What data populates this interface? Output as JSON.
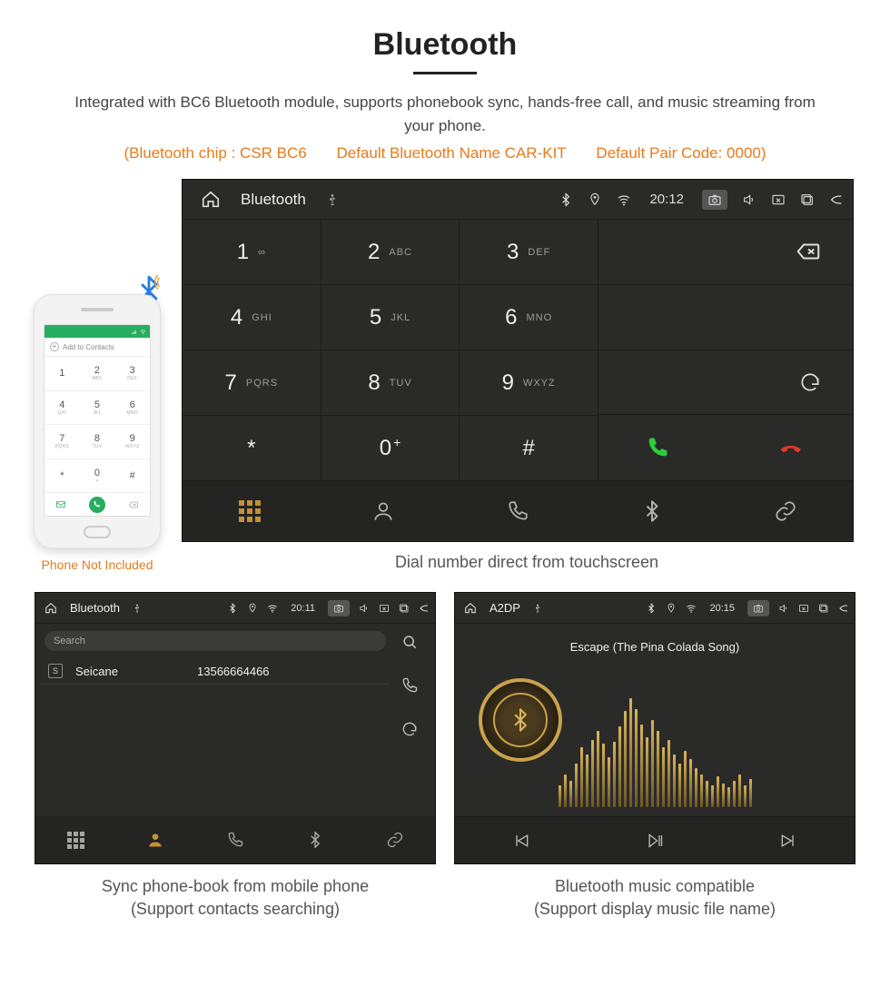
{
  "header": {
    "title": "Bluetooth",
    "subtitle": "Integrated with BC6 Bluetooth module, supports phonebook sync, hands-free call, and music streaming from your phone.",
    "spec_chip": "(Bluetooth chip : CSR BC6",
    "spec_name": "Default Bluetooth Name CAR-KIT",
    "spec_code": "Default Pair Code: 0000)"
  },
  "phone": {
    "header_label": "Add to Contacts",
    "pad": [
      {
        "n": "1",
        "s": ""
      },
      {
        "n": "2",
        "s": "ABC"
      },
      {
        "n": "3",
        "s": "DEF"
      },
      {
        "n": "4",
        "s": "GHI"
      },
      {
        "n": "5",
        "s": "JKL"
      },
      {
        "n": "6",
        "s": "MNO"
      },
      {
        "n": "7",
        "s": "PQRS"
      },
      {
        "n": "8",
        "s": "TUV"
      },
      {
        "n": "9",
        "s": "WXYZ"
      },
      {
        "n": "*",
        "s": ""
      },
      {
        "n": "0",
        "s": "+"
      },
      {
        "n": "#",
        "s": ""
      }
    ],
    "caption": "Phone Not Included"
  },
  "dialer": {
    "title": "Bluetooth",
    "time": "20:12",
    "keys": [
      {
        "n": "1",
        "s": "∞"
      },
      {
        "n": "2",
        "s": "ABC"
      },
      {
        "n": "3",
        "s": "DEF"
      },
      {
        "n": "4",
        "s": "GHI"
      },
      {
        "n": "5",
        "s": "JKL"
      },
      {
        "n": "6",
        "s": "MNO"
      },
      {
        "n": "7",
        "s": "PQRS"
      },
      {
        "n": "8",
        "s": "TUV"
      },
      {
        "n": "9",
        "s": "WXYZ"
      },
      {
        "n": "*",
        "s": ""
      },
      {
        "n": "0",
        "s": ""
      },
      {
        "n": "#",
        "s": ""
      }
    ],
    "zero_sup": "+",
    "caption": "Dial number direct from touchscreen"
  },
  "phonebook": {
    "title": "Bluetooth",
    "time": "20:11",
    "search_placeholder": "Search",
    "contact_badge": "S",
    "contact_name": "Seicane",
    "contact_number": "13566664466",
    "caption_line1": "Sync phone-book from mobile phone",
    "caption_line2": "(Support contacts searching)"
  },
  "music": {
    "title": "A2DP",
    "time": "20:15",
    "track": "Escape (The Pina Colada Song)",
    "viz_heights": [
      20,
      30,
      24,
      40,
      55,
      48,
      62,
      70,
      58,
      46,
      60,
      74,
      88,
      100,
      90,
      76,
      64,
      80,
      70,
      55,
      62,
      48,
      40,
      52,
      44,
      36,
      30,
      24,
      20,
      28,
      22,
      18,
      24,
      30,
      20,
      26
    ],
    "caption_line1": "Bluetooth music compatible",
    "caption_line2": "(Support display music file name)"
  }
}
